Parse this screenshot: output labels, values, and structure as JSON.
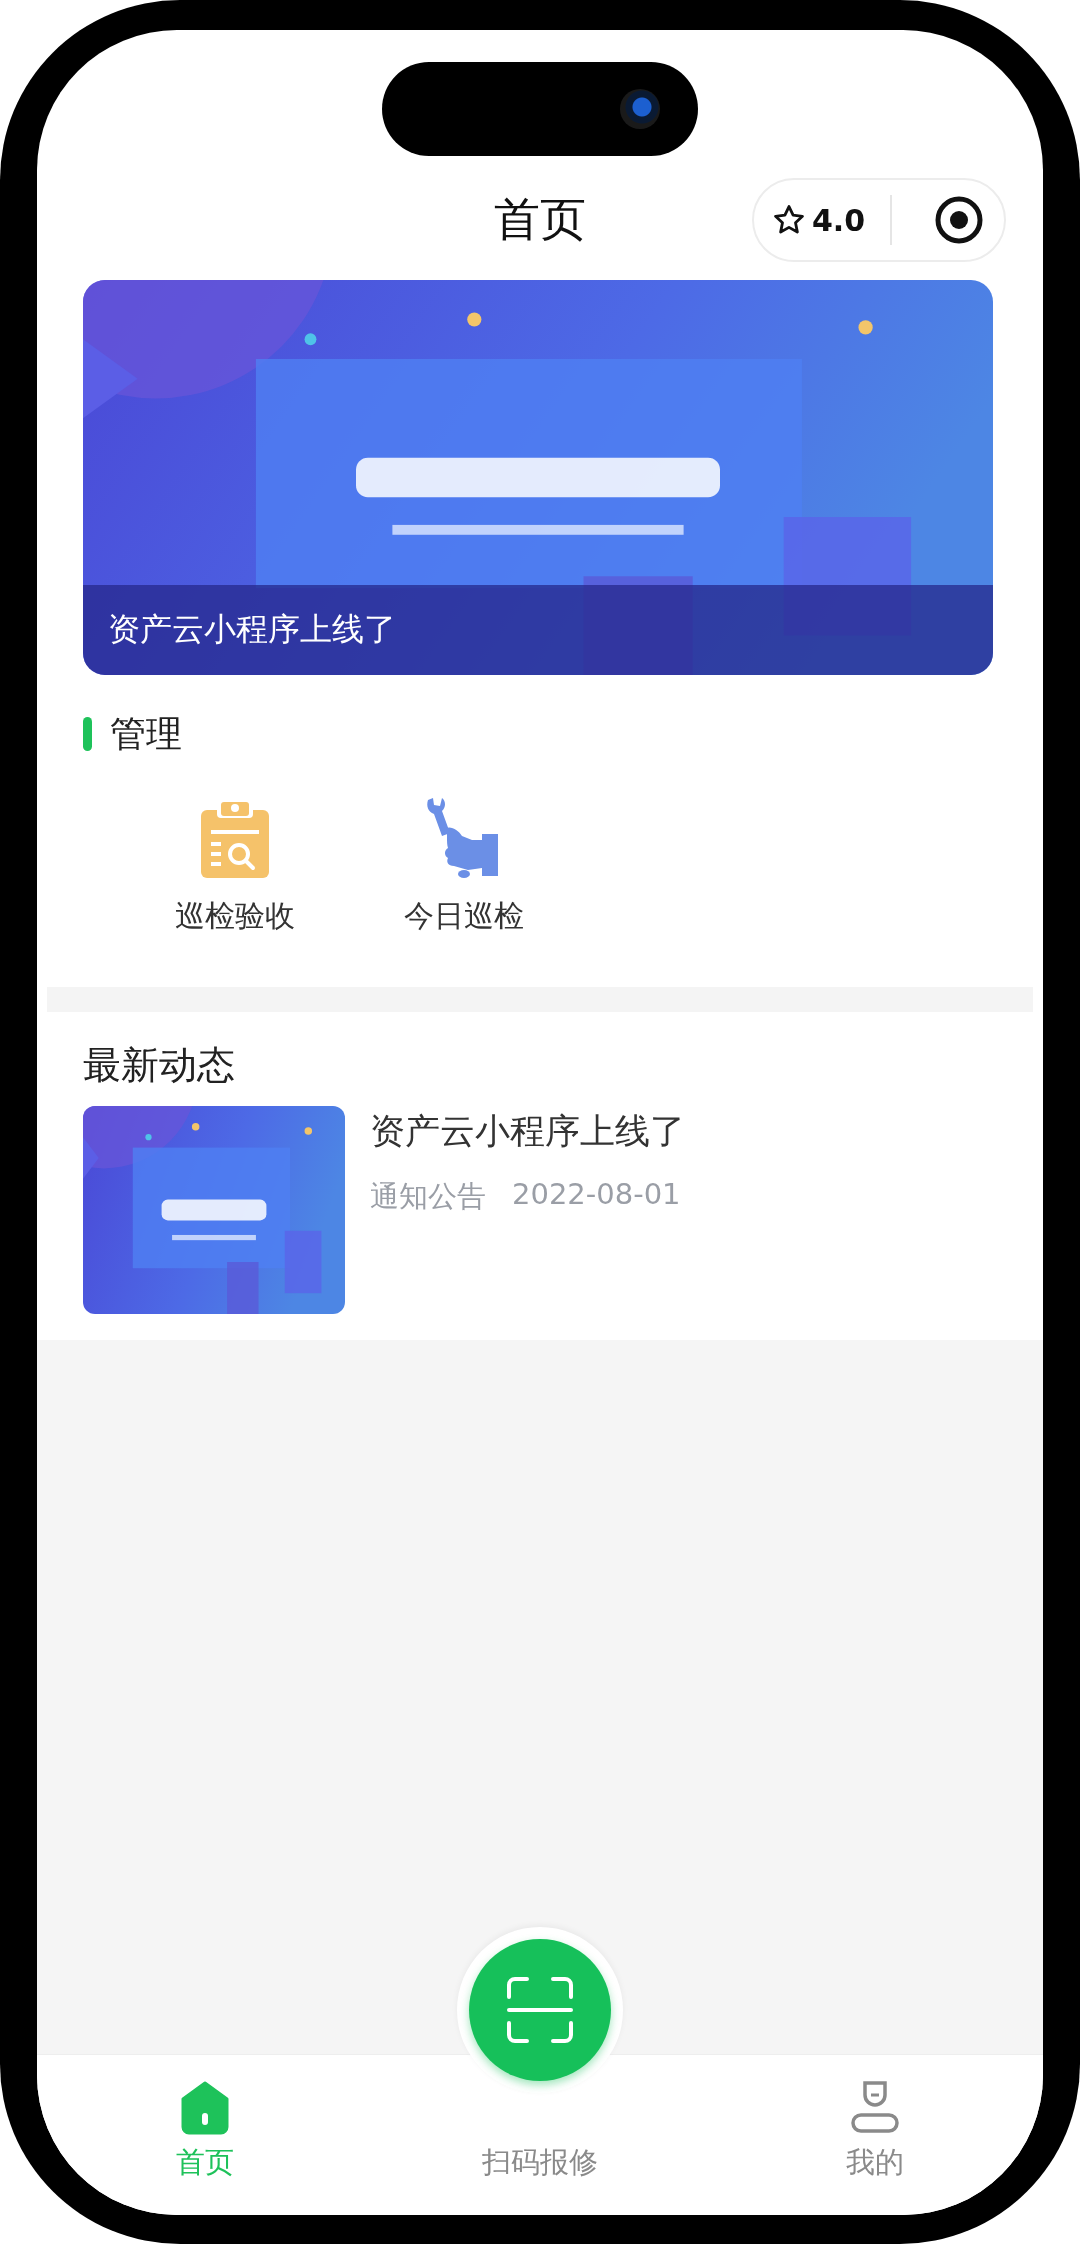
{
  "header": {
    "title": "首页",
    "rating": "4.0"
  },
  "banner": {
    "kind": "picture",
    "caption": "资产云小程序上线了"
  },
  "section": {
    "title": "管理",
    "items": [
      {
        "label": "巡检验收",
        "kind": "clipboard"
      },
      {
        "label": "今日巡检",
        "kind": "wrench"
      }
    ]
  },
  "news": {
    "title": "最新动态",
    "items": [
      {
        "title": "资产云小程序上线了",
        "category": "通知公告",
        "date": "2022-08-01"
      }
    ]
  },
  "tab_bar": {
    "items": [
      {
        "label": "首页",
        "kind": "home",
        "selected": true
      },
      {
        "label": "扫码报修",
        "kind": "scan",
        "selected": false
      },
      {
        "label": "我的",
        "kind": "profile",
        "selected": false
      }
    ]
  }
}
